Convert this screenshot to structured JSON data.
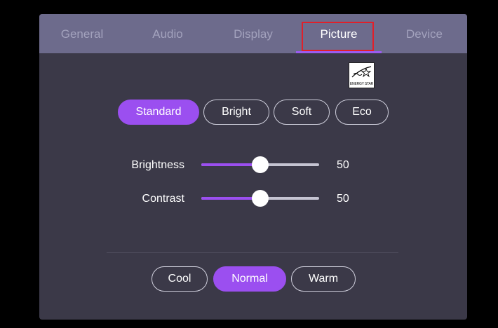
{
  "tabs": [
    {
      "label": "General"
    },
    {
      "label": "Audio"
    },
    {
      "label": "Display"
    },
    {
      "label": "Picture"
    },
    {
      "label": "Device"
    }
  ],
  "active_tab": "Picture",
  "energy_star": {
    "label": "ENERGY STAR"
  },
  "modes": [
    {
      "label": "Standard",
      "selected": true
    },
    {
      "label": "Bright",
      "selected": false
    },
    {
      "label": "Soft",
      "selected": false
    },
    {
      "label": "Eco",
      "selected": false
    }
  ],
  "sliders": [
    {
      "label": "Brightness",
      "value": 50
    },
    {
      "label": "Contrast",
      "value": 50
    }
  ],
  "color_temp": [
    {
      "label": "Cool",
      "selected": false
    },
    {
      "label": "Normal",
      "selected": true
    },
    {
      "label": "Warm",
      "selected": false
    }
  ],
  "colors": {
    "accent": "#9b4ff0",
    "panel": "#3b3948",
    "tabbar": "#6d6b8c",
    "highlight": "#e0202a"
  }
}
